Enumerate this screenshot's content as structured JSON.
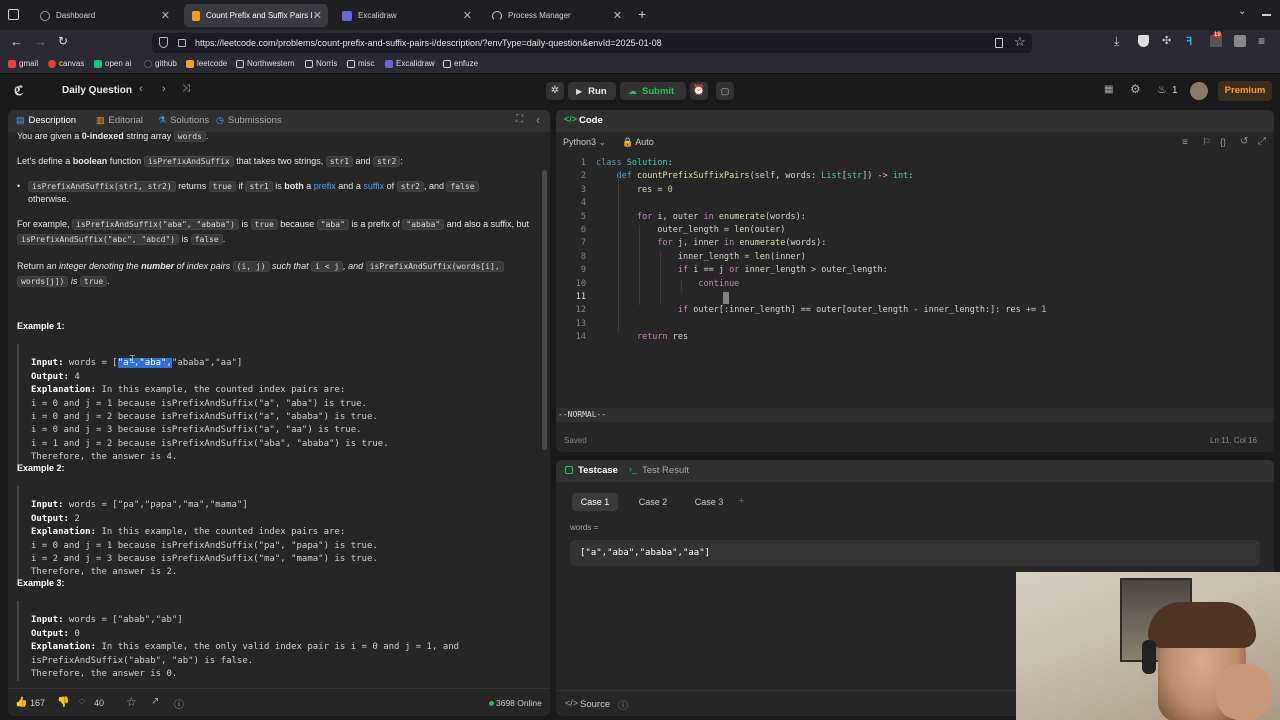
{
  "browser": {
    "tabs": [
      {
        "title": "Dashboard",
        "active": false
      },
      {
        "title": "Count Prefix and Suffix Pairs I -",
        "active": true
      },
      {
        "title": "Excalidraw",
        "active": false
      },
      {
        "title": "Process Manager",
        "active": false
      }
    ],
    "new_tab": "+",
    "url": "https://leetcode.com/problems/count-prefix-and-suffix-pairs-i/description/?envType=daily-question&envId=2025-01-08",
    "bookmarks": [
      "gmail",
      "canvas",
      "open ai",
      "github",
      "leetcode",
      "Northwestern",
      "Norris",
      "misc",
      "Excalidraw",
      "enfuze"
    ],
    "ext_badge": "19"
  },
  "lc": {
    "daily_question": "Daily Question",
    "run": "Run",
    "submit": "Submit",
    "streak": "1",
    "premium": "Premium"
  },
  "left_tabs": [
    "Description",
    "Editorial",
    "Solutions",
    "Submissions"
  ],
  "description": {
    "line1_pre": "You are given a ",
    "line1_bold": "0-indexed",
    "line1_post": " string array ",
    "line1_code": "words",
    "line1_end": ".",
    "line2_pre": "Let's define a ",
    "line2_bold": "boolean",
    "line2_mid": " function ",
    "line2_code1": "isPrefixAndSuffix",
    "line2_mid2": " that takes two strings, ",
    "line2_code2": "str1",
    "line2_and": " and ",
    "line2_code3": "str2",
    "line2_end": ":",
    "bullet_code1": "isPrefixAndSuffix(str1, str2)",
    "bullet_t1": " returns ",
    "bullet_code2": "true",
    "bullet_t2": " if ",
    "bullet_code3": "str1",
    "bullet_t3": " is ",
    "bullet_bold": "both",
    "bullet_t4": " a ",
    "bullet_link1": "prefix",
    "bullet_t5": " and a ",
    "bullet_link2": "suffix",
    "bullet_t6": " of ",
    "bullet_code4": "str2",
    "bullet_t7": ", and ",
    "bullet_code5": "false",
    "bullet_t8": "otherwise.",
    "ex_pre": "For example, ",
    "ex_code1": "isPrefixAndSuffix(\"aba\", \"ababa\")",
    "ex_t1": " is ",
    "ex_code2": "true",
    "ex_t2": " because ",
    "ex_code3": "\"aba\"",
    "ex_t3": " is a prefix of ",
    "ex_code4": "\"ababa\"",
    "ex_t4": " and also a suffix, but",
    "ex_code5": "isPrefixAndSuffix(\"abc\", \"abcd\")",
    "ex_t5": " is ",
    "ex_code6": "false",
    "ex_t6": ".",
    "ret_t1": "Return ",
    "ret_i1": "an integer denoting the ",
    "ret_b1": "number",
    "ret_i2": " of index pairs ",
    "ret_code1": "(i, j)",
    "ret_i3": " such that ",
    "ret_code2": "i < j",
    "ret_i4": ", and ",
    "ret_code3": "isPrefixAndSuffix(words[i],",
    "ret_code4": "words[j])",
    "ret_i5": " is ",
    "ret_code5": "true",
    "ret_end": "."
  },
  "examples": [
    {
      "title": "Example 1:",
      "input_label": "Input:",
      "input_pre": " words = [",
      "input_hl": "\"a\",\"aba\",",
      "input_post": "\"ababa\",\"aa\"]",
      "output_label": "Output:",
      "output": " 4",
      "expl_label": "Explanation:",
      "expl": " In this example, the counted index pairs are:",
      "lines": [
        "i = 0 and j = 1 because isPrefixAndSuffix(\"a\", \"aba\") is true.",
        "i = 0 and j = 2 because isPrefixAndSuffix(\"a\", \"ababa\") is true.",
        "i = 0 and j = 3 because isPrefixAndSuffix(\"a\", \"aa\") is true.",
        "i = 1 and j = 2 because isPrefixAndSuffix(\"aba\", \"ababa\") is true.",
        "Therefore, the answer is 4."
      ]
    },
    {
      "title": "Example 2:",
      "input_label": "Input:",
      "input": " words = [\"pa\",\"papa\",\"ma\",\"mama\"]",
      "output_label": "Output:",
      "output": " 2",
      "expl_label": "Explanation:",
      "expl": " In this example, the counted index pairs are:",
      "lines": [
        "i = 0 and j = 1 because isPrefixAndSuffix(\"pa\", \"papa\") is true.",
        "i = 2 and j = 3 because isPrefixAndSuffix(\"ma\", \"mama\") is true.",
        "Therefore, the answer is 2."
      ]
    },
    {
      "title": "Example 3:",
      "input_label": "Input:",
      "input": " words = [\"abab\",\"ab\"]",
      "output_label": "Output:",
      "output": " 0",
      "expl_label": "Explanation:",
      "expl": " In this example, the only valid index pair is i = 0 and j = 1, and",
      "lines": [
        "isPrefixAndSuffix(\"abab\", \"ab\") is false.",
        "Therefore, the answer is 0."
      ]
    }
  ],
  "left_footer": {
    "likes": "167",
    "comments": "40",
    "online": "3698 Online"
  },
  "code_panel": {
    "title": "Code",
    "language": "Python3",
    "auto": "Auto",
    "mode": "--NORMAL--",
    "saved": "Saved",
    "cursor": "Ln 11, Col 16",
    "lines": [
      "class Solution:",
      "    def countPrefixSuffixPairs(self, words: List[str]) -> int:",
      "        res = 0",
      "",
      "        for i, outer in enumerate(words):",
      "            outer_length = len(outer)",
      "            for j, inner in enumerate(words):",
      "                inner_length = len(inner)",
      "                if i == j or inner_length > outer_length:",
      "                    continue",
      "",
      "                if outer[:inner_length] == outer[outer_length - inner_length:]: res += 1",
      "",
      "        return res"
    ]
  },
  "testcase": {
    "tab1": "Testcase",
    "tab2": "Test Result",
    "cases": [
      "Case 1",
      "Case 2",
      "Case 3"
    ],
    "add": "+",
    "label": "words =",
    "value": "[\"a\",\"aba\",\"ababa\",\"aa\"]",
    "source": "Source"
  }
}
